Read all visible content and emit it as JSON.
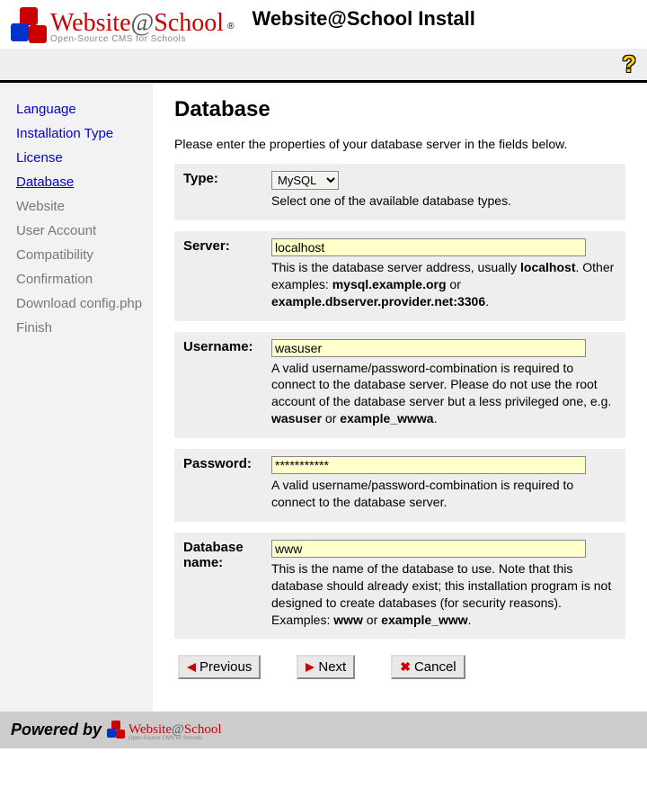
{
  "brand": {
    "name_part1": "Website",
    "name_at": "@",
    "name_part2": "School",
    "tagline": "Open-Source CMS for Schools",
    "reg": "®"
  },
  "header": {
    "title": "Website@School Install"
  },
  "nav": {
    "items": [
      {
        "label": "Language",
        "state": "done"
      },
      {
        "label": "Installation Type",
        "state": "done"
      },
      {
        "label": "License",
        "state": "done"
      },
      {
        "label": "Database",
        "state": "active"
      },
      {
        "label": "Website",
        "state": "todo"
      },
      {
        "label": "User Account",
        "state": "todo"
      },
      {
        "label": "Compatibility",
        "state": "todo"
      },
      {
        "label": "Confirmation",
        "state": "todo"
      },
      {
        "label": "Download config.php",
        "state": "todo"
      },
      {
        "label": "Finish",
        "state": "todo"
      }
    ]
  },
  "page": {
    "title": "Database",
    "intro": "Please enter the properties of your database server in the fields below."
  },
  "form": {
    "type": {
      "label": "Type:",
      "value": "MySQL",
      "desc": "Select one of the available database types."
    },
    "server": {
      "label": "Server:",
      "value": "localhost",
      "desc_pre": "This is the database server address, usually ",
      "bold1": "localhost",
      "desc_mid": ". Other examples: ",
      "bold2": "mysql.example.org",
      "desc_mid2": " or ",
      "bold3": "example.dbserver.provider.net:3306",
      "desc_end": "."
    },
    "username": {
      "label": "Username:",
      "value": "wasuser",
      "desc_pre": "A valid username/password-combination is required to connect to the database server. Please do not use the root account of the database server but a less privileged one, e.g. ",
      "bold1": "wasuser",
      "desc_mid": " or ",
      "bold2": "example_wwwa",
      "desc_end": "."
    },
    "password": {
      "label": "Password:",
      "value": "***********",
      "desc": "A valid username/password-combination is required to connect to the database server."
    },
    "dbname": {
      "label": "Database name:",
      "value": "www",
      "desc_pre": "This is the name of the database to use. Note that this database should already exist; this installation program is not designed to create databases (for security reasons). Examples: ",
      "bold1": "www",
      "desc_mid": " or ",
      "bold2": "example_www",
      "desc_end": "."
    }
  },
  "buttons": {
    "previous": "Previous",
    "next": "Next",
    "cancel": "Cancel"
  },
  "footer": {
    "powered": "Powered by"
  }
}
